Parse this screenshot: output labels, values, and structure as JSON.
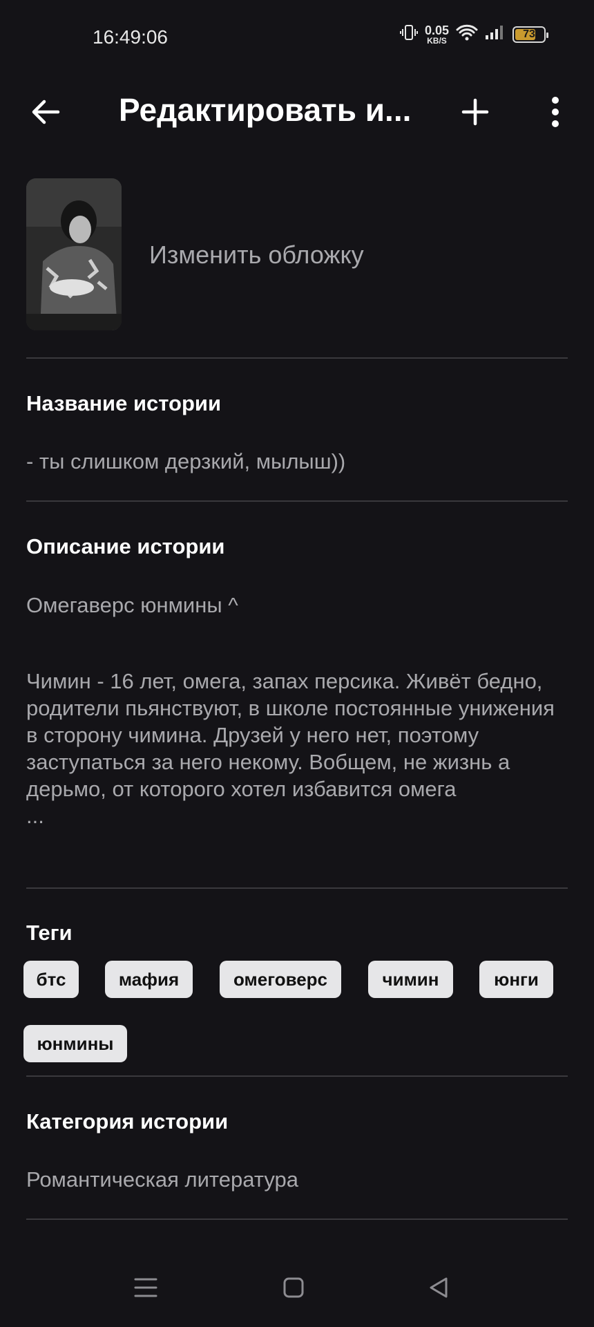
{
  "status_bar": {
    "time": "16:49:06",
    "net_speed_value": "0.05",
    "net_speed_unit": "KB/S",
    "battery_level": "73",
    "battery_fraction": 0.73,
    "battery_color": "#c99a2e",
    "icons": [
      "vibrate-icon",
      "wifi-icon",
      "signal-icon",
      "battery-icon"
    ]
  },
  "app_bar": {
    "title": "Редактировать и...",
    "back_icon": "arrow-left-icon",
    "add_icon": "plus-icon",
    "more_icon": "more-vertical-icon"
  },
  "cover": {
    "change_label": "Изменить обложку"
  },
  "story": {
    "title_label": "Название истории",
    "title_value": "- ты слишком дерзкий, мылыш))",
    "description_label": "Описание истории",
    "description_line1": "Омегаверс юнмины ^",
    "description_body": "Чимин - 16 лет, омега, запах персика. Живёт бедно, родители пьянствуют, в школе постоянные унижения в сторону чимина. Друзей у него нет, поэтому заступаться за него некому. Вобщем, не жизнь а дерьмо, от которого хотел избавится омега",
    "description_ellipsis": "...",
    "tags_label": "Теги",
    "tags": [
      "бтс",
      "мафия",
      "омеговерс",
      "чимин",
      "юнги",
      "юнмины"
    ],
    "category_label": "Категория истории",
    "category_value": "Романтическая литература"
  },
  "nav_bar": {
    "icons": [
      "menu-icon",
      "home-square-icon",
      "back-triangle-icon"
    ]
  },
  "colors": {
    "background": "#141317",
    "primary_text": "#ffffff",
    "secondary_text": "#a9a9ad",
    "divider": "#3a393d",
    "tag_bg": "#e6e6e8"
  }
}
